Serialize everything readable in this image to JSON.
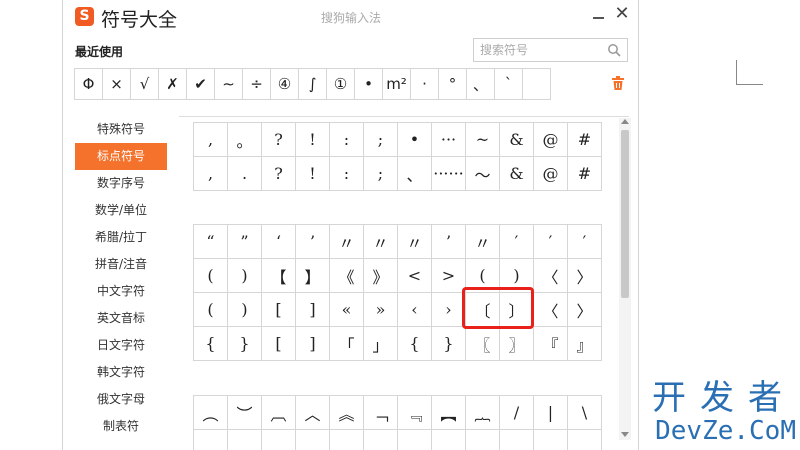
{
  "window": {
    "logo": "S",
    "title": "符号大全",
    "subtitle": "搜狗输入法",
    "close": "✕"
  },
  "recent": {
    "label": "最近使用",
    "items": [
      "Φ",
      "×",
      "√",
      "✗",
      "✔",
      "∼",
      "÷",
      "④",
      "∫",
      "①",
      "•",
      "m²",
      "·",
      "°",
      "、",
      "`",
      ""
    ]
  },
  "search": {
    "placeholder": "搜索符号"
  },
  "sidebar": {
    "items": [
      "特殊符号",
      "标点符号",
      "数字序号",
      "数学/单位",
      "希腊/拉丁",
      "拼音/注音",
      "中文字符",
      "英文音标",
      "日文字符",
      "韩文字符",
      "俄文字母",
      "制表符"
    ],
    "active_index": 1
  },
  "symbol_groups": [
    [
      [
        ",",
        "。",
        "?",
        "!",
        ":",
        ";",
        "•",
        "···",
        "~",
        "&",
        "@",
        "#"
      ],
      [
        ",",
        ".",
        "?",
        "!",
        ":",
        ";",
        "、",
        "······",
        "～",
        "&",
        "@",
        "#"
      ]
    ],
    [
      [
        "“",
        "”",
        "‘",
        "’",
        "〃",
        "〃",
        "〃",
        "’",
        "〃",
        "′",
        "′",
        "′"
      ],
      [
        "(",
        ")",
        "【",
        "】",
        "《",
        "》",
        "<",
        ">",
        "(",
        ")",
        "〈",
        "〉"
      ],
      [
        "(",
        ")",
        "[",
        "]",
        "«",
        "»",
        "‹",
        "›",
        "〔",
        "〕",
        "〈",
        "〉"
      ],
      [
        "{",
        "}",
        "[",
        "]",
        "「",
        "」",
        "{",
        "}",
        "〖",
        "〗",
        "『",
        "』"
      ]
    ],
    [
      [
        "︵",
        "︶",
        "︹",
        "︿",
        "︽",
        "﹁",
        "﹃",
        "︻",
        "︷",
        "/",
        "|",
        "\\"
      ],
      [
        "",
        "",
        "",
        "",
        "",
        "",
        "",
        "",
        "",
        "",
        "",
        ""
      ]
    ]
  ],
  "watermark": {
    "cn": "开发者",
    "en": "DevZe.CoM"
  },
  "colors": {
    "accent": "#f4722b",
    "highlight": "#e8221b",
    "watermark": "#2a6fb3"
  }
}
